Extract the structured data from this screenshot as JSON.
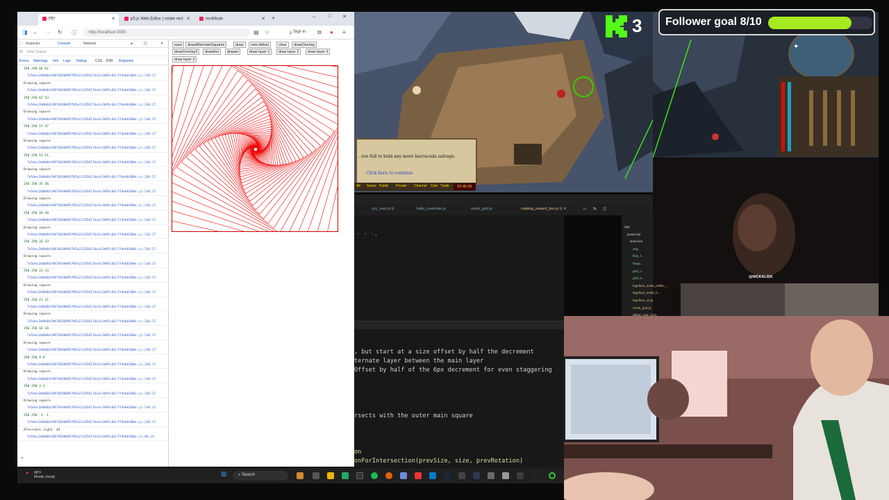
{
  "browser": {
    "tabs": [
      {
        "label": "P5*",
        "color": "#ed225d"
      },
      {
        "label": "p5.js Web Editor | rotate rect",
        "color": "#ed225d"
      },
      {
        "label": "rectMode",
        "color": "#ed225d"
      }
    ],
    "url": "http://localhost:3000",
    "signin": "Sign in"
  },
  "devtools": {
    "tabs": [
      "Inspector",
      "Console",
      "Network"
    ],
    "filter_placeholder": "Filter Output",
    "levels": [
      "Errors",
      "Warnings",
      "Info",
      "Logs",
      "Debug",
      "CSS",
      "XHR",
      "Requests"
    ],
    "lines": [
      {
        "t": "num",
        "v": "250 250 66 61"
      },
      {
        "t": "ref",
        "v": "7e5dec2b0b6b19874630095705e21335617be3c3b95c02c7f4eb0180e.js:110:17"
      },
      {
        "t": "msg",
        "v": "Drawing square"
      },
      {
        "t": "ref",
        "v": "7e5dec2b0b6b19874630095705e21335617be3c3b95c02c7f4eb0180e.js:110:17"
      },
      {
        "t": "num",
        "v": "250 250 62 53"
      },
      {
        "t": "ref",
        "v": "7e5dec2b0b6b19874630095705e21335617be3c3b95c02c7f4eb0180e.js:110:17"
      },
      {
        "t": "msg",
        "v": "Drawing square"
      },
      {
        "t": "ref",
        "v": "7e5dec2b0b6b19874630095705e21335617be3c3b95c02c7f4eb0180e.js:110:17"
      },
      {
        "t": "num",
        "v": "250 250 57 47"
      },
      {
        "t": "ref",
        "v": "7e5dec2b0b6b19874630095705e21335617be3c3b95c02c7f4eb0180e.js:110:17"
      },
      {
        "t": "msg",
        "v": "Drawing square"
      },
      {
        "t": "ref",
        "v": "7e5dec2b0b6b19874630095705e21335617be3c3b95c02c7f4eb0180e.js:110:17"
      },
      {
        "t": "num",
        "v": "250 250 53 51"
      },
      {
        "t": "ref",
        "v": "7e5dec2b0b6b19874630095705e21335617be3c3b95c02c7f4eb0180e.js:110:17"
      },
      {
        "t": "msg",
        "v": "Drawing square"
      },
      {
        "t": "ref",
        "v": "7e5dec2b0b6b19874630095705e21335617be3c3b95c02c7f4eb0180e.js:110:17"
      },
      {
        "t": "num",
        "v": "250 250 35 36"
      },
      {
        "t": "ref",
        "v": "7e5dec2b0b6b19874630095705e21335617be3c3b95c02c7f4eb0180e.js:110:17"
      },
      {
        "t": "msg",
        "v": "Drawing square"
      },
      {
        "t": "ref",
        "v": "7e5dec2b0b6b19874630095705e21335617be3c3b95c02c7f4eb0180e.js:110:17"
      },
      {
        "t": "num",
        "v": "250 250 28 28"
      },
      {
        "t": "ref",
        "v": "7e5dec2b0b6b19874630095705e21335617be3c3b95c02c7f4eb0180e.js:110:17"
      },
      {
        "t": "msg",
        "v": "Drawing square"
      },
      {
        "t": "ref",
        "v": "7e5dec2b0b6b19874630095705e21335617be3c3b95c02c7f4eb0180e.js:110:17"
      },
      {
        "t": "num",
        "v": "250 250 33 33"
      },
      {
        "t": "ref",
        "v": "7e5dec2b0b6b19874630095705e21335617be3c3b95c02c7f4eb0180e.js:110:17"
      },
      {
        "t": "msg",
        "v": "Drawing square"
      },
      {
        "t": "ref",
        "v": "7e5dec2b0b6b19874630095705e21335617be3c3b95c02c7f4eb0180e.js:110:17"
      },
      {
        "t": "num",
        "v": "250 250 23 23"
      },
      {
        "t": "ref",
        "v": "7e5dec2b0b6b19874630095705e21335617be3c3b95c02c7f4eb0180e.js:110:17"
      },
      {
        "t": "msg",
        "v": "Drawing square"
      },
      {
        "t": "ref",
        "v": "7e5dec2b0b6b19874630095705e21335617be3c3b95c02c7f4eb0180e.js:110:17"
      },
      {
        "t": "num",
        "v": "250 250 21 21"
      },
      {
        "t": "ref",
        "v": "7e5dec2b0b6b19874630095705e21335617be3c3b95c02c7f4eb0180e.js:110:17"
      },
      {
        "t": "msg",
        "v": "Drawing square"
      },
      {
        "t": "ref",
        "v": "7e5dec2b0b6b19874630095705e21335617be3c3b95c02c7f4eb0180e.js:110:17"
      },
      {
        "t": "num",
        "v": "250 250 16 16"
      },
      {
        "t": "ref",
        "v": "7e5dec2b0b6b19874630095705e21335617be3c3b95c02c7f4eb0180e.js:110:17"
      },
      {
        "t": "msg",
        "v": "Drawing square"
      },
      {
        "t": "ref",
        "v": "7e5dec2b0b6b19874630095705e21335617be3c3b95c02c7f4eb0180e.js:110:17"
      },
      {
        "t": "num",
        "v": "250 250 9 9"
      },
      {
        "t": "ref",
        "v": "7e5dec2b0b6b19874630095705e21335617be3c3b95c02c7f4eb0180e.js:110:17"
      },
      {
        "t": "msg",
        "v": "Drawing square"
      },
      {
        "t": "ref",
        "v": "7e5dec2b0b6b19874630095705e21335617be3c3b95c02c7f4eb0180e.js:110:17"
      },
      {
        "t": "num",
        "v": "250 250 3 3"
      },
      {
        "t": "ref",
        "v": "7e5dec2b0b6b19874630095705e21335617be3c3b95c02c7f4eb0180e.js:110:17"
      },
      {
        "t": "msg",
        "v": "Drawing square"
      },
      {
        "t": "ref",
        "v": "7e5dec2b0b6b19874630095705e21335617be3c3b95c02c7f4eb0180e.js:110:17"
      },
      {
        "t": "num",
        "v": "250 250 -1 -1"
      },
      {
        "t": "ref",
        "v": "7e5dec2b0b6b19874630095705e21335617be3c3b95c02c7f4eb0180e.js:110:17"
      },
      {
        "t": "msg",
        "v": "Alternate right: 44"
      },
      {
        "t": "ref",
        "v": "7e5dec2b0b6b19874630095705e21335617be3c3b95c02c7f4eb0180e.js:46:13"
      }
    ]
  },
  "p5": {
    "buttons": [
      "save",
      "drawAlternateSquares",
      "draw",
      "new ribbon",
      "clear",
      "drawOverlay",
      "drawOverlay3",
      "drawHor",
      "drawer",
      "draw layer 1",
      "draw layer 2",
      "draw layer 3",
      "draw layer 3"
    ]
  },
  "taskbar": {
    "weather": "88°F",
    "weather_sub": "Mostly cloudy",
    "search": "Search"
  },
  "game": {
    "chat_text": "...too full to hold any more barracuda salvage.",
    "chat_click": "Click here to continue",
    "chat_tabs": [
      "All",
      "Game",
      "Public",
      "Private",
      "Channel",
      "Clan",
      "Trade"
    ],
    "clock": "02:45:06"
  },
  "overlay": {
    "badge_number": "3",
    "follower_goal": "Follower goal 8/10",
    "goal_progress": 0.8,
    "cam_tag": "@NICKALISK"
  },
  "editor": {
    "tabs": [
      {
        "label": "circ_over.js",
        "status": "U"
      },
      {
        "label": "hello_controller.js",
        "status": ""
      },
      {
        "label": "mesh_grid.js",
        "status": ""
      },
      {
        "label": "rotating_inward_box.js",
        "status": "U"
      }
    ],
    "explorer": [
      "app",
      "javascript",
      "sketches",
      "orig",
      "flow_f...",
      "frequ...",
      "grid_c...",
      "grid_s...",
      "logoface_scale_buffer_...",
      "logoface_scale_b...",
      "logoface_v1.js",
      "mesh_grid.js",
      "ribbon_svg_v2.js"
    ],
    "code_lines": [
      ", but start at a size offset by half the decrement",
      "ternate layer between the main layer",
      " Offset by half of the 6px decrement for even staggering",
      "rsects with the outer main square",
      "on",
      "onForIntersection(prevSize, size, prevRotation)"
    ],
    "partial": "- - -,"
  }
}
